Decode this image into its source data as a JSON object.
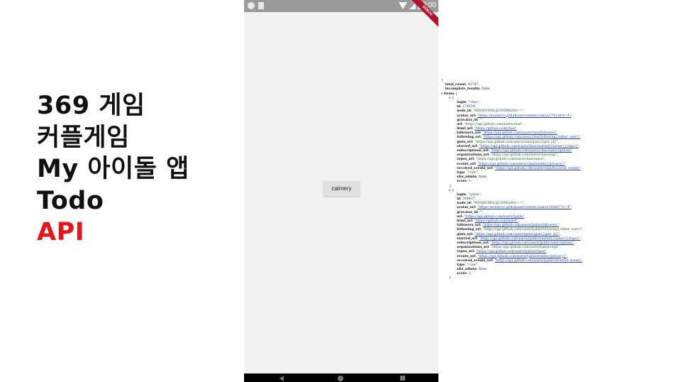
{
  "titles": [
    "369 게임",
    "커플게임",
    "My 아이돌 앱",
    "Todo",
    "API"
  ],
  "colors": {
    "title": "#111111",
    "accent": "#e8141b",
    "debug_banner": "#b3122a"
  },
  "phone": {
    "status_time": "10:00",
    "debug_label": "DEBUG",
    "button_label": "calmery"
  },
  "json_viewer": {
    "lines": [
      {
        "indent": 0,
        "text": "{"
      },
      {
        "indent": 1,
        "key": "total_count",
        "value": "42747",
        "vtype": "number"
      },
      {
        "indent": 1,
        "key": "incomplete_results",
        "value": "false",
        "vtype": "bool"
      },
      {
        "indent": 0,
        "toggle": "▸",
        "key": "items",
        "value": "[",
        "vtype": "plain"
      },
      {
        "indent": 2,
        "toggle": "▸",
        "text": "{"
      },
      {
        "indent": 4,
        "key": "login",
        "value": "\"chas\"",
        "vtype": "string"
      },
      {
        "indent": 4,
        "key": "id",
        "value": "174334",
        "vtype": "number"
      },
      {
        "indent": 4,
        "key": "node_id",
        "value": "\"MDQ6VXNlcjE3NDMzNA==\"",
        "vtype": "string"
      },
      {
        "indent": 4,
        "key": "avatar_url",
        "value": "\"https://avatars3.githubusercontent.com/u/174334?v=4\"",
        "vtype": "link"
      },
      {
        "indent": 4,
        "key": "gravatar_id",
        "value": "\"\"",
        "vtype": "string"
      },
      {
        "indent": 4,
        "key": "url",
        "value": "\"https://api.github.com/users/chas\"",
        "vtype": "string"
      },
      {
        "indent": 4,
        "key": "html_url",
        "value": "\"https://github.com/chas\"",
        "vtype": "link"
      },
      {
        "indent": 4,
        "key": "followers_url",
        "value": "\"https://api.github.com/users/chas/followers\"",
        "vtype": "link"
      },
      {
        "indent": 4,
        "key": "following_url",
        "value": "\"https://api.github.com/users/chas/following{/other_user}\"",
        "vtype": "link"
      },
      {
        "indent": 4,
        "key": "gists_url",
        "value": "\"https://api.github.com/users/chas/gists{/gist_id}\"",
        "vtype": "string"
      },
      {
        "indent": 4,
        "key": "starred_url",
        "value": "\"https://api.github.com/users/chas/starred{/owner}{/repo}\"",
        "vtype": "link"
      },
      {
        "indent": 4,
        "key": "subscriptions_url",
        "value": "\"https://api.github.com/users/chas/subscriptions\"",
        "vtype": "link"
      },
      {
        "indent": 4,
        "key": "organizations_url",
        "value": "\"https://api.github.com/users/chas/orgs\"",
        "vtype": "string"
      },
      {
        "indent": 4,
        "key": "repos_url",
        "value": "\"https://api.github.com/users/chas/repos\"",
        "vtype": "string"
      },
      {
        "indent": 4,
        "key": "events_url",
        "value": "\"https://api.github.com/users/chas/events{/privacy}\"",
        "vtype": "link"
      },
      {
        "indent": 4,
        "key": "received_events_url",
        "value": "\"https://api.github.com/users/chas/received_events\"",
        "vtype": "link"
      },
      {
        "indent": 4,
        "key": "type",
        "value": "\"User\"",
        "vtype": "string"
      },
      {
        "indent": 4,
        "key": "site_admin",
        "value": "false",
        "vtype": "bool"
      },
      {
        "indent": 4,
        "key": "score",
        "value": "1",
        "vtype": "number"
      },
      {
        "indent": 2,
        "text": "},"
      },
      {
        "indent": 2,
        "toggle": "▸",
        "text": "{"
      },
      {
        "indent": 4,
        "key": "login",
        "value": "\"tjable\"",
        "vtype": "string"
      },
      {
        "indent": 4,
        "key": "id",
        "value": "164437",
        "vtype": "number"
      },
      {
        "indent": 4,
        "key": "node_id",
        "value": "\"MDQ6VXNlcjE2NDQzNw==\"",
        "vtype": "string"
      },
      {
        "indent": 4,
        "key": "avatar_url",
        "value": "\"https://avatars2.githubusercontent.com/u/164437?v=4\"",
        "vtype": "link"
      },
      {
        "indent": 4,
        "key": "gravatar_id",
        "value": "\"\"",
        "vtype": "string"
      },
      {
        "indent": 4,
        "key": "url",
        "value": "\"https://api.github.com/users/tjable\"",
        "vtype": "link"
      },
      {
        "indent": 4,
        "key": "html_url",
        "value": "\"https://github.com/tjable\"",
        "vtype": "link"
      },
      {
        "indent": 4,
        "key": "followers_url",
        "value": "\"https://api.github.com/users/tjable/followers\"",
        "vtype": "link"
      },
      {
        "indent": 4,
        "key": "following_url",
        "value": "\"https://api.github.com/users/tjable/following{/other_user}\"",
        "vtype": "string"
      },
      {
        "indent": 4,
        "key": "gists_url",
        "value": "\"https://api.github.com/users/tjable/gists{/gist_id}\"",
        "vtype": "link"
      },
      {
        "indent": 4,
        "key": "starred_url",
        "value": "\"https://api.github.com/users/tjable/starred{/owner}{/repo}\"",
        "vtype": "link"
      },
      {
        "indent": 4,
        "key": "subscriptions_url",
        "value": "\"https://api.github.com/users/tjable/subscriptions\"",
        "vtype": "link"
      },
      {
        "indent": 4,
        "key": "organizations_url",
        "value": "\"https://api.github.com/users/tjable/orgs\"",
        "vtype": "string"
      },
      {
        "indent": 4,
        "key": "repos_url",
        "value": "\"https://api.github.com/users/tjable/repos\"",
        "vtype": "link"
      },
      {
        "indent": 4,
        "key": "events_url",
        "value": "\"https://api.github.com/users/tjable/events{/privacy}\"",
        "vtype": "link"
      },
      {
        "indent": 4,
        "key": "received_events_url",
        "value": "\"https://api.github.com/users/tjable/received_events\"",
        "vtype": "link"
      },
      {
        "indent": 4,
        "key": "type",
        "value": "\"User\"",
        "vtype": "string"
      },
      {
        "indent": 4,
        "key": "site_admin",
        "value": "false",
        "vtype": "bool"
      },
      {
        "indent": 4,
        "key": "score",
        "value": "1",
        "vtype": "number"
      },
      {
        "indent": 2,
        "text": "}"
      }
    ]
  }
}
